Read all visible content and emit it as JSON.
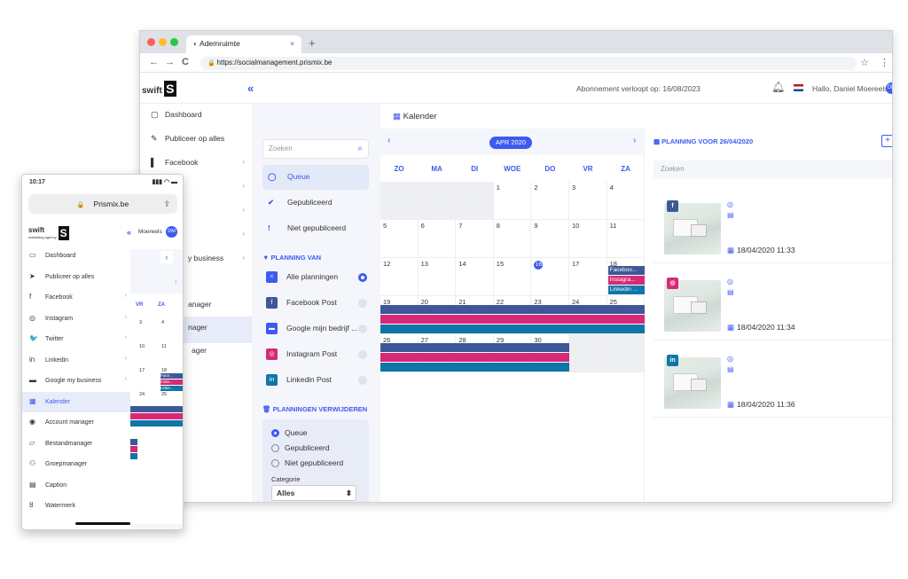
{
  "browser": {
    "tab_title": "Ademruimte",
    "tab_close": "×",
    "new_tab": "+",
    "url": "https://socialmanagement.prismix.be",
    "nav_back": "←",
    "nav_forward": "→",
    "nav_reload": "C",
    "star": "☆",
    "menu": "⋮"
  },
  "header": {
    "logo_text": "swift",
    "logo_mark": "S",
    "collapse": "«",
    "subscription": "Abonnement verloopt op: 16/08/2023",
    "greeting": "Hallo, Daniel Moereels",
    "avatar": "DM"
  },
  "sidebar": {
    "items": [
      {
        "label": "Dashboard",
        "icon": "▢"
      },
      {
        "label": "Publiceer op alles",
        "icon": "✎"
      },
      {
        "label": "Facebook",
        "icon": "▌"
      },
      {
        "label": "y business",
        "icon": ""
      },
      {
        "label": "anager",
        "icon": ""
      },
      {
        "label": "nager",
        "icon": ""
      },
      {
        "label": "ager",
        "icon": ""
      }
    ],
    "chevron": "›"
  },
  "filter": {
    "search_placeholder": "Zoeken",
    "options": [
      {
        "label": "Queue",
        "icon": "◯"
      },
      {
        "label": "Gepubliceerd",
        "icon": "✔"
      },
      {
        "label": "Niet gepubliceerd",
        "icon": "!"
      }
    ],
    "planning_van": "PLANNING VAN",
    "planning_items": [
      {
        "label": "Alle planningen",
        "icon": "<",
        "color": "#3d5af1",
        "checked": true
      },
      {
        "label": "Facebook Post",
        "icon": "f",
        "color": "#3b5998",
        "checked": false
      },
      {
        "label": "Google mijn bedrijf ...",
        "icon": "▬",
        "color": "#3d5af1",
        "checked": false
      },
      {
        "label": "Instagram Post",
        "icon": "◎",
        "color": "#d62976",
        "checked": false
      },
      {
        "label": "Linkedin Post",
        "icon": "in",
        "color": "#0e76a8",
        "checked": false
      }
    ],
    "delete_header": "PLANNINGEN VERWIJDEREN",
    "delete_options": [
      "Queue",
      "Gepubliceerd",
      "Niet gepubliceerd"
    ],
    "category_label": "Categorie",
    "category_value": "Alles",
    "category_arrow": "⬍"
  },
  "calendar": {
    "title": "Kalender",
    "month": "APR 2020",
    "prev": "‹",
    "next": "›",
    "weekdays": [
      "ZO",
      "MA",
      "DI",
      "WOE",
      "DO",
      "VR",
      "ZA"
    ],
    "days": [
      "",
      "",
      "",
      "1",
      "2",
      "3",
      "4",
      "5",
      "6",
      "7",
      "8",
      "9",
      "10",
      "11",
      "12",
      "13",
      "14",
      "15",
      "16",
      "17",
      "18",
      "19",
      "20",
      "21",
      "22",
      "23",
      "24",
      "25",
      "26",
      "27",
      "28",
      "29",
      "30",
      "",
      ""
    ],
    "events": [
      {
        "label": "Faceboo...",
        "color": "#3b5998"
      },
      {
        "label": "Instagra...",
        "color": "#d62976"
      },
      {
        "label": "Linkedin ...",
        "color": "#0e76a8"
      }
    ]
  },
  "planning": {
    "header": "PLANNING VOOR 26/04/2020",
    "add": "+",
    "search_placeholder": "Zoeken",
    "cards": [
      {
        "network": "f",
        "color": "#3b5998",
        "date": "18/04/2020 11:33"
      },
      {
        "network": "◎",
        "color": "#d62976",
        "date": "18/04/2020 11:34"
      },
      {
        "network": "in",
        "color": "#0e76a8",
        "date": "18/04/2020 11:36"
      }
    ],
    "menu": "⋮"
  },
  "phone": {
    "time": "10:17",
    "signal": "▮▮▮ ◠ ▬",
    "address": "Prismix.be",
    "lock": "🔒",
    "share": "⇪",
    "logo_text": "swift",
    "logo_sub": "marketing agency",
    "logo_mark": "S",
    "collapse": "«",
    "user": "Moereels",
    "avatar": "DM",
    "menu": [
      {
        "label": "Dashboard",
        "icon": "▭",
        "chev": false,
        "active": false
      },
      {
        "label": "Publiceer op alles",
        "icon": "➤",
        "chev": false,
        "active": false
      },
      {
        "label": "Facebook",
        "icon": "f",
        "chev": true,
        "active": false
      },
      {
        "label": "Instagram",
        "icon": "◎",
        "chev": true,
        "active": false
      },
      {
        "label": "Twitter",
        "icon": "🐦",
        "chev": true,
        "active": false
      },
      {
        "label": "Linkedin",
        "icon": "in",
        "chev": true,
        "active": false
      },
      {
        "label": "Google my business",
        "icon": "▬",
        "chev": true,
        "active": false
      },
      {
        "label": "Kalender",
        "icon": "▦",
        "chev": false,
        "active": true
      },
      {
        "label": "Account manager",
        "icon": "◉",
        "chev": false,
        "active": false
      },
      {
        "label": "Bestandmanager",
        "icon": "▱",
        "chev": false,
        "active": false
      },
      {
        "label": "Groepmanager",
        "icon": "⚇",
        "chev": false,
        "active": false
      },
      {
        "label": "Caption",
        "icon": "▤",
        "chev": false,
        "active": false
      },
      {
        "label": "Watermerk",
        "icon": "ȣ",
        "chev": false,
        "active": false
      }
    ],
    "cal_prev": "‹",
    "cal_next": "›",
    "cal_weekdays": [
      "VR",
      "ZA"
    ],
    "cal_days": [
      "3",
      "4",
      "10",
      "11",
      "17",
      "18",
      "24",
      "25"
    ],
    "cal_events": [
      "Face...",
      "Insta...",
      "Linke..."
    ]
  }
}
